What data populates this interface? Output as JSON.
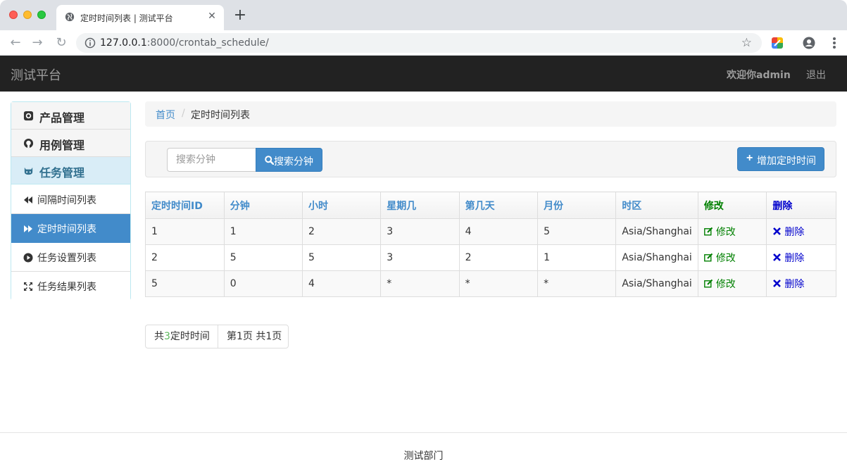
{
  "browser": {
    "tab_title": "定时时间列表 | 测试平台",
    "url_host": "127.0.0.1",
    "url_rest": ":8000/crontab_schedule/"
  },
  "navbar": {
    "brand": "测试平台",
    "welcome": "欢迎你admin",
    "logout": "退出"
  },
  "sidebar": {
    "sections": [
      {
        "label": "产品管理",
        "icon": "github-icon"
      },
      {
        "label": "用例管理",
        "icon": "github-icon"
      },
      {
        "label": "任务管理",
        "icon": "github-alt-icon"
      }
    ],
    "items": [
      {
        "label": "间隔时间列表",
        "icon": "backward-icon",
        "active": false
      },
      {
        "label": "定时时间列表",
        "icon": "forward-icon",
        "active": true
      },
      {
        "label": "任务设置列表",
        "icon": "play-circle-icon",
        "active": false
      },
      {
        "label": "任务结果列表",
        "icon": "fullscreen-icon",
        "active": false
      }
    ]
  },
  "breadcrumb": {
    "home": "首页",
    "separator": "/",
    "current": "定时时间列表"
  },
  "search": {
    "placeholder": "搜索分钟",
    "button": "搜索分钟"
  },
  "add_button": "增加定时时间",
  "table": {
    "headers": [
      "定时时间ID",
      "分钟",
      "小时",
      "星期几",
      "第几天",
      "月份",
      "时区",
      "修改",
      "删除"
    ],
    "rows": [
      {
        "id": "1",
        "minute": "1",
        "hour": "2",
        "weekday": "3",
        "day": "4",
        "month": "5",
        "tz": "Asia/Shanghai"
      },
      {
        "id": "2",
        "minute": "5",
        "hour": "5",
        "weekday": "3",
        "day": "2",
        "month": "1",
        "tz": "Asia/Shanghai"
      },
      {
        "id": "5",
        "minute": "0",
        "hour": "4",
        "weekday": "*",
        "day": "*",
        "month": "*",
        "tz": "Asia/Shanghai"
      }
    ],
    "edit_label": "修改",
    "delete_label": "删除"
  },
  "pagination": {
    "total_prefix": "共",
    "total_count": "3",
    "total_suffix": "定时时间",
    "page_info": "第1页 共1页"
  },
  "footer": "测试部门",
  "colors": {
    "primary": "#428bca",
    "navbar": "#222222",
    "edit": "#008000",
    "delete": "#0000cc",
    "active_section_bg": "#d9edf7"
  }
}
